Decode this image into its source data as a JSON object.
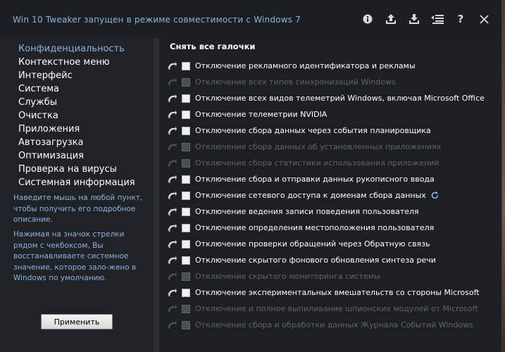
{
  "window": {
    "title": "Win 10 Tweaker запущен в режиме совместимости с Windows 7",
    "title_icons": [
      "info-icon",
      "upload-icon",
      "download-icon",
      "list-icon",
      "help-icon",
      "close-icon"
    ],
    "help_glyph": "?"
  },
  "sidebar": {
    "items": [
      {
        "label": "Конфиденциальность",
        "active": true
      },
      {
        "label": "Контекстное меню",
        "active": false
      },
      {
        "label": "Интерфейс",
        "active": false
      },
      {
        "label": "Система",
        "active": false
      },
      {
        "label": "Службы",
        "active": false
      },
      {
        "label": "Очистка",
        "active": false
      },
      {
        "label": "Приложения",
        "active": false
      },
      {
        "label": "Автозагрузка",
        "active": false
      },
      {
        "label": "Оптимизация",
        "active": false
      },
      {
        "label": "Проверка на вирусы",
        "active": false
      },
      {
        "label": "Системная информация",
        "active": false
      }
    ],
    "help1": "Наведите мышь на любой пункт, чтобы получить его подробное описание.",
    "help2": "Нажимая на значок стрелки рядом с чекбоксом, Вы восстанавливаете системное значение, которое зало-жено в Windows по умолчанию.",
    "apply_label": "Применить"
  },
  "main": {
    "uncheck_all": "Снять все галочки",
    "tweaks": [
      {
        "label": "Отключение рекламного идентификатора и рекламы",
        "enabled": true
      },
      {
        "label": "Отключение всех типов синхронизаций Windows",
        "enabled": false
      },
      {
        "label": "Отключение всех видов телеметрий Windows, включая Microsoft Office",
        "enabled": true
      },
      {
        "label": "Отключение телеметрии NVIDIA",
        "enabled": true
      },
      {
        "label": "Отключение сбора данных через события планировщика",
        "enabled": true
      },
      {
        "label": "Отключение сбора данных об установленных приложениях",
        "enabled": false
      },
      {
        "label": "Отключение сбора статистики использования приложений",
        "enabled": false
      },
      {
        "label": "Отключение сбора и отправки данных рукописного ввода",
        "enabled": true
      },
      {
        "label": "Отключение сетевого доступа к доменам сбора данных",
        "enabled": true,
        "refresh": true
      },
      {
        "label": "Отключение ведения записи поведения пользователя",
        "enabled": true
      },
      {
        "label": "Отключение определения местоположения пользователя",
        "enabled": true
      },
      {
        "label": "Отключение проверки обращений через Обратную связь",
        "enabled": true
      },
      {
        "label": "Отключение скрытого фонового обновления синтеза речи",
        "enabled": true
      },
      {
        "label": "Отключение скрытого мониторинга системы",
        "enabled": false
      },
      {
        "label": "Отключение экспериментальных вмешательств со стороны Microsoft",
        "enabled": true
      },
      {
        "label": "Отключение и полное выпиливание шпионских модулей от Microsoft",
        "enabled": false
      },
      {
        "label": "Отключение сбора и обработки данных Журнала Событий Windows",
        "enabled": false
      }
    ]
  },
  "colors": {
    "accent": "#8eb1dc",
    "text": "#ffffff",
    "disabled_text": "#5f6469",
    "window_bg": "#1c2024",
    "sidebar_bg": "#1f2327"
  }
}
